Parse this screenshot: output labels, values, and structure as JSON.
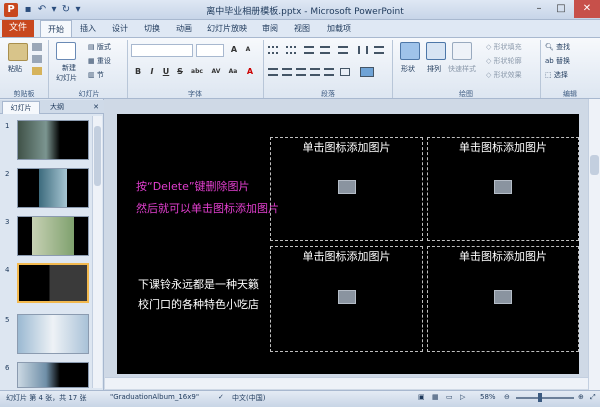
{
  "window": {
    "title": "离中毕业相册模板.pptx - Microsoft PowerPoint",
    "app_icon": "P",
    "minimize": "–",
    "maximize": "□",
    "close": "✕"
  },
  "quick_access": {
    "save": "💾",
    "undo": "↶",
    "redo": "↻",
    "more": "▾"
  },
  "ribbon_tabs": {
    "file": "文件",
    "home": "开始",
    "insert": "插入",
    "design": "设计",
    "transitions": "切换",
    "animations": "动画",
    "slideshow": "幻灯片放映",
    "review": "审阅",
    "view": "视图",
    "addins": "加载项"
  },
  "ribbon": {
    "clipboard": {
      "paste": "粘贴",
      "label": "剪贴板"
    },
    "slides": {
      "new_slide": "新建",
      "new_slide2": "幻灯片",
      "layout": "版式",
      "reset": "重设",
      "section": "节",
      "label": "幻灯片"
    },
    "font": {
      "label": "字体",
      "bold": "B",
      "italic": "I",
      "underline": "U",
      "strike": "S",
      "shadow": "abc",
      "spacing": "AV",
      "case": "Aa",
      "color": "A"
    },
    "paragraph": {
      "label": "段落"
    },
    "drawing": {
      "shapes": "形状",
      "arrange": "排列",
      "quick_styles": "快速样式",
      "fill": "形状填充",
      "outline": "形状轮廓",
      "effects": "形状效果",
      "label": "绘图"
    },
    "editing": {
      "find": "查找",
      "replace": "替换",
      "select": "选择",
      "label": "编辑"
    }
  },
  "panel": {
    "tab_slides": "幻灯片",
    "tab_outline": "大纲",
    "close": "✕",
    "slide_numbers": [
      "1",
      "2",
      "3",
      "4",
      "5",
      "6"
    ]
  },
  "slide": {
    "caption_pink_1": "按“Delete”键删除图片",
    "caption_pink_2": "然后就可以单击图标添加图片",
    "caption_white_1": "下课铃永远都是一种天籁",
    "caption_white_2": "校门口的各种特色小吃店",
    "placeholders": [
      "单击图标添加图片",
      "单击图标添加图片",
      "单击图标添加图片",
      "单击图标添加图片"
    ]
  },
  "status": {
    "slide_info": "幻灯片 第 4 张，共 17 张",
    "theme": "\"GraduationAlbum_16x9\"",
    "language": "中文(中国)",
    "zoom": "58%"
  },
  "colors": {
    "accent_file_tab": "#c8471e",
    "caption_pink": "#e33fd0",
    "selected_thumb_border": "#f2b94f"
  }
}
